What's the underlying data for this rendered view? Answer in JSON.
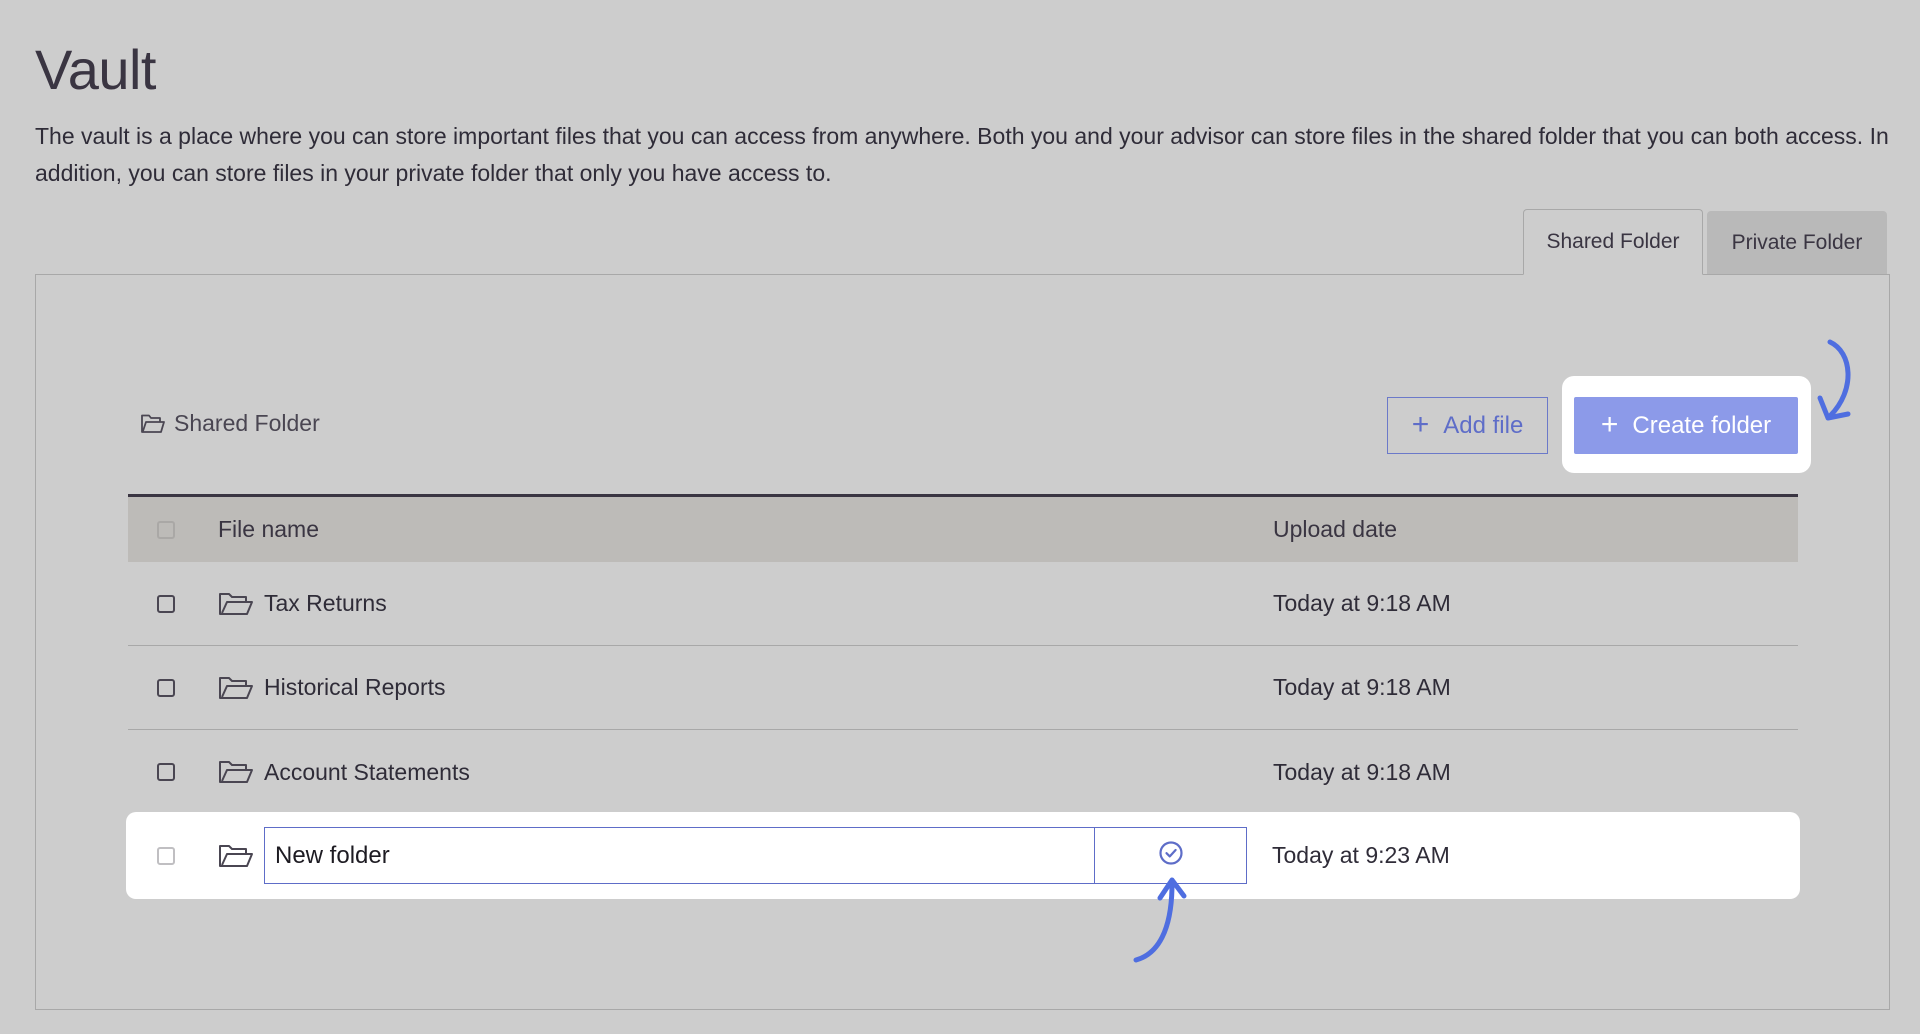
{
  "page": {
    "title": "Vault",
    "description": "The vault is a place where you can store important files that you can access from anywhere. Both you and your advisor can store files in the shared folder that you can both access. In addition, you can store files in your private folder that only you have access to."
  },
  "tabs": {
    "shared": "Shared Folder",
    "private": "Private Folder",
    "active": "Shared Folder"
  },
  "breadcrumb": {
    "label": "Shared Folder",
    "icon": "folder-open-icon"
  },
  "actions": {
    "add_file": "Add file",
    "create_folder": "Create folder",
    "plus_glyph": "+"
  },
  "table": {
    "headers": {
      "name": "File name",
      "date": "Upload date"
    },
    "rows": [
      {
        "name": "Tax Returns",
        "date": "Today at 9:18 AM"
      },
      {
        "name": "Historical Reports",
        "date": "Today at 9:18 AM"
      },
      {
        "name": "Account Statements",
        "date": "Today at 9:18 AM"
      }
    ],
    "new_row": {
      "name_value": "New folder",
      "date": "Today at 9:23 AM"
    }
  },
  "colors": {
    "background": "#cdcdcd",
    "accent": "#5e6dc8",
    "create_button": "#8c9ae9",
    "annotation_arrow": "#4f6ee0",
    "header_row": "#bdbbb8"
  }
}
